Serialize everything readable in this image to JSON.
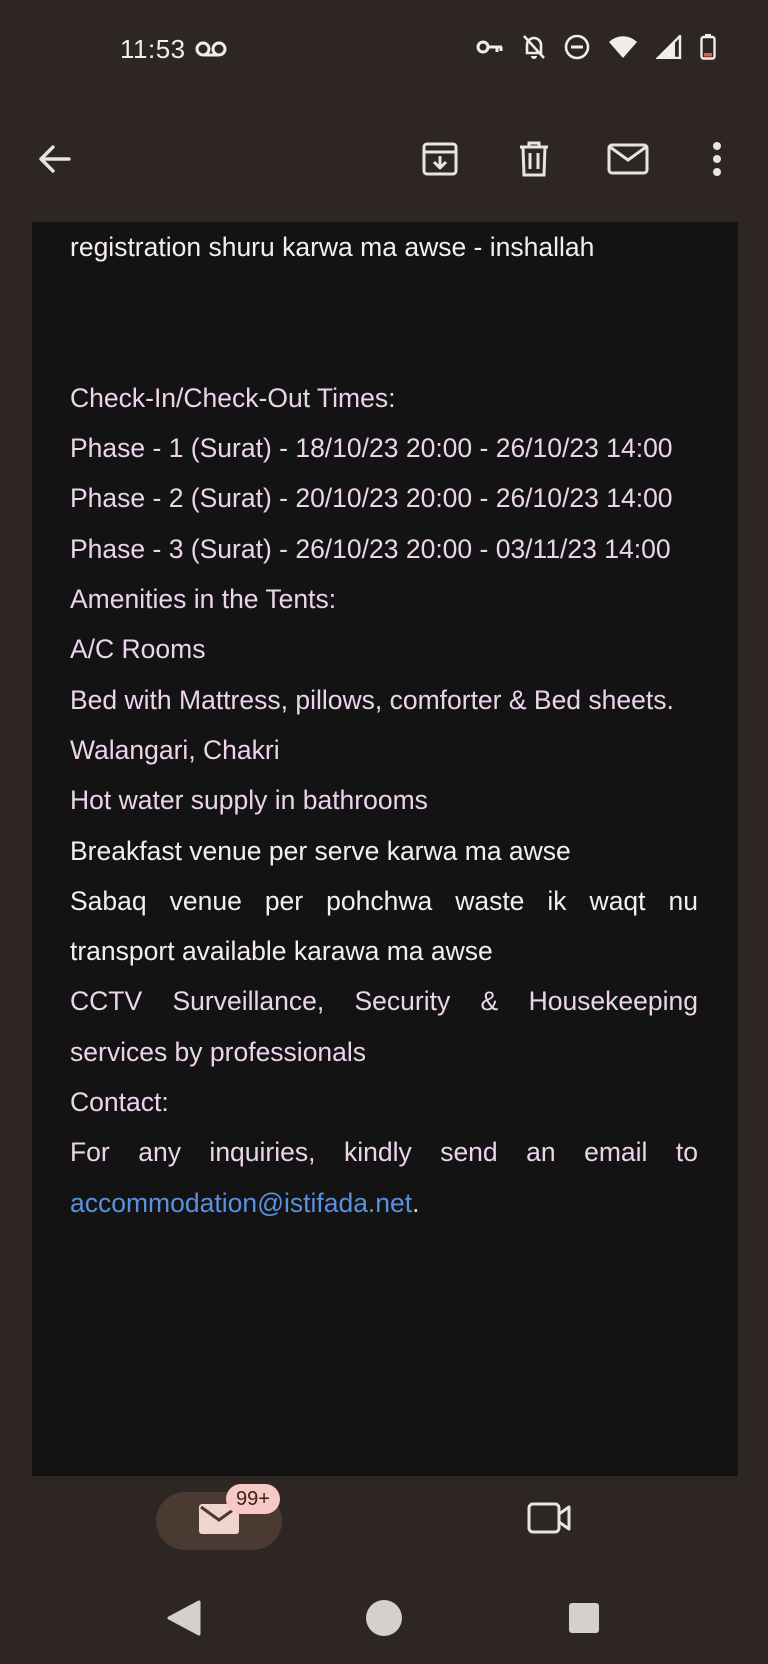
{
  "status_bar": {
    "time": "11:53",
    "icons": [
      "voicemail-icon",
      "vpn-key-icon",
      "notifications-off-icon",
      "do-not-disturb-icon",
      "wifi-icon",
      "signal-icon",
      "battery-icon"
    ]
  },
  "toolbar": {
    "icons": [
      "back-arrow-icon",
      "archive-icon",
      "delete-icon",
      "mark-unread-icon",
      "more-vert-icon"
    ]
  },
  "email": {
    "line_registration": "registration shuru karwa ma awse - inshallah",
    "checkin_heading": "Check-In/Check-Out Times:",
    "phase1": "Phase - 1 (Surat) - 18/10/23 20:00 - 26/10/23 14:00",
    "phase2": "Phase - 2 (Surat) - 20/10/23 20:00 - 26/10/23 14:00",
    "phase3": "Phase - 3 (Surat) - 26/10/23 20:00 - 03/11/23 14:00",
    "amenities_heading": "Amenities in the Tents:",
    "amenity_ac": "A/C Rooms",
    "amenity_bed": "Bed with Mattress, pillows, comforter & Bed sheets.",
    "amenity_walangari": "Walangari, Chakri",
    "amenity_hotwater": "Hot water supply in bathrooms",
    "breakfast": "Breakfast venue per serve karwa ma awse",
    "sabaq": "Sabaq venue per pohchwa waste ik waqt nu transport available karawa ma awse",
    "cctv": "CCTV Surveillance, Security & Housekeeping services by professionals",
    "contact_heading": "Contact:",
    "contact_text": "For any inquiries, kindly send an email to",
    "contact_email": "accommodation@istifada.net",
    "contact_period": "."
  },
  "bottom_nav": {
    "mail_badge": "99+",
    "icons": [
      "mail-icon",
      "video-call-icon"
    ]
  },
  "colors": {
    "background": "#2d2622",
    "card": "#131313",
    "text_pink": "#ecd4ec",
    "text_white": "#f4efec",
    "link": "#5b8fdf",
    "badge": "#f7c9c4"
  }
}
